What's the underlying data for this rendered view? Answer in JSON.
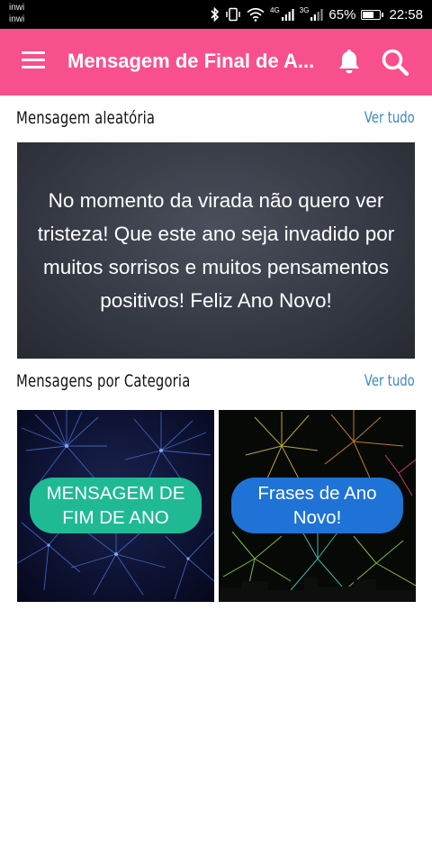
{
  "status_bar": {
    "carrier_1": "inwi",
    "carrier_2": "inwi",
    "network_1": "4G",
    "network_2": "3G",
    "battery_percent": "65%",
    "battery_level": 0.65,
    "time": "22:58",
    "icons": [
      "bluetooth-icon",
      "vibrate-icon",
      "wifi-icon",
      "signal-icon",
      "battery-icon"
    ]
  },
  "app_bar": {
    "title": "Mensagem de Final de A...",
    "background": "#f8508c",
    "icons": [
      "menu-icon",
      "bell-icon",
      "search-icon"
    ]
  },
  "random_section": {
    "title": "Mensagem aleatória",
    "see_all": "Ver tudo",
    "message": "No momento da virada não quero ver tristeza! Que este ano seja invadido por muitos sorrisos e muitos pensamentos positivos! Feliz Ano Novo!"
  },
  "category_section": {
    "title": "Mensagens por Categoria",
    "see_all": "Ver tudo",
    "categories": [
      {
        "label": "MENSAGEM DE FIM DE ANO",
        "color": "#1fba94"
      },
      {
        "label": "Frases de Ano Novo!",
        "color": "#1f73d6"
      }
    ]
  },
  "colors": {
    "accent": "#f8508c",
    "link": "#3a88c7"
  }
}
